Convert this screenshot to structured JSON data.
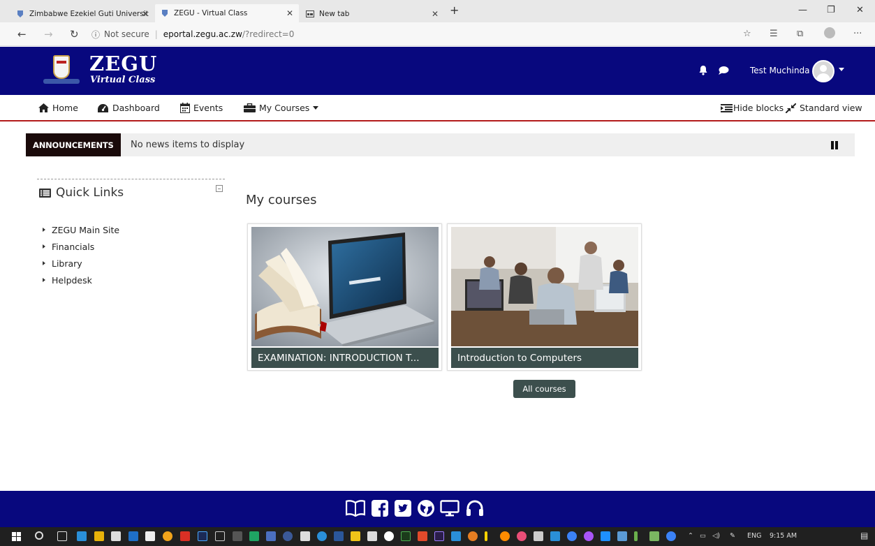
{
  "browser": {
    "tabs": [
      {
        "title": "Zimbabwe Ezekiel Guti Universit"
      },
      {
        "title": "ZEGU - Virtual Class"
      },
      {
        "title": "New tab"
      }
    ],
    "address": {
      "security": "Not secure",
      "host": "eportal.zegu.ac.zw",
      "path": "/?redirect=0"
    }
  },
  "site": {
    "brand": "ZEGU",
    "brand_sub": "Virtual Class",
    "user_name": "Test Muchinda"
  },
  "nav": {
    "home": "Home",
    "dashboard": "Dashboard",
    "events": "Events",
    "my_courses": "My Courses",
    "hide_blocks": "Hide blocks",
    "standard_view": "Standard view"
  },
  "announcements": {
    "label": "ANNOUNCEMENTS",
    "text": "No news items to display"
  },
  "quick_links": {
    "title": "Quick Links",
    "items": [
      "ZEGU Main Site",
      "Financials",
      "Library",
      "Helpdesk"
    ]
  },
  "courses": {
    "title": "My courses",
    "items": [
      {
        "name": "EXAMINATION: INTRODUCTION T..."
      },
      {
        "name": "Introduction to Computers"
      }
    ],
    "all_courses": "All courses"
  },
  "taskbar": {
    "lang": "ENG",
    "time": "9:15 AM"
  },
  "colors": {
    "header_bg": "#08087e",
    "nav_border": "#b31b1b",
    "card_caption": "#3c4f4d",
    "announce_label": "#1a0a0a"
  }
}
